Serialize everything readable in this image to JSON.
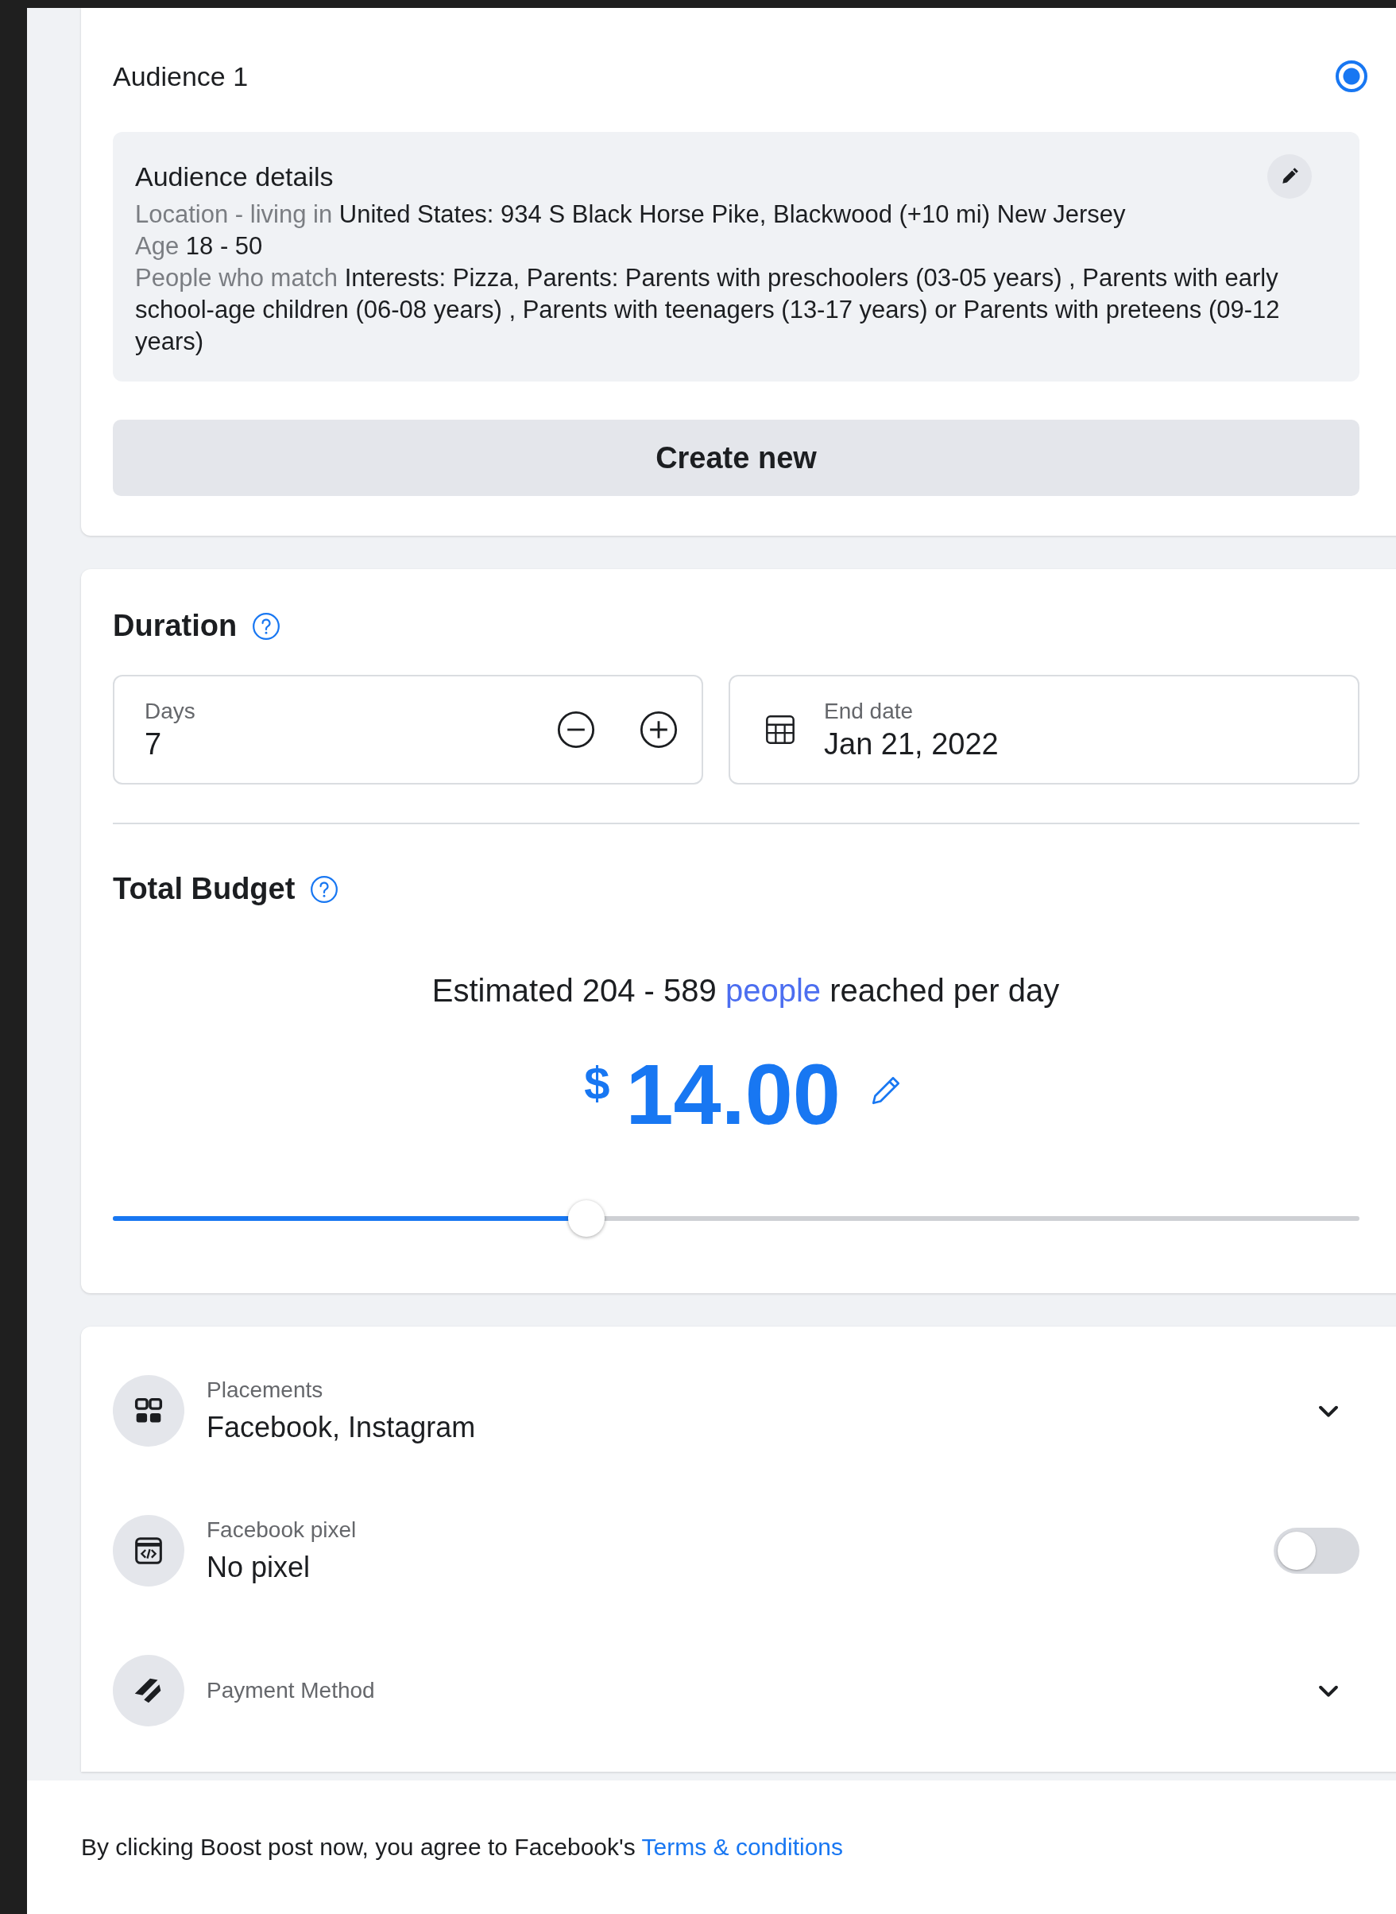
{
  "audience": {
    "name": "Audience 1",
    "selected": true,
    "details": {
      "title": "Audience details",
      "lines": [
        {
          "label": "Location - living in",
          "value": "United States: 934 S Black Horse Pike, Blackwood (+10 mi) New Jersey"
        },
        {
          "label": "Age",
          "value": "18 - 50"
        },
        {
          "label": "People who match",
          "value": "Interests: Pizza, Parents: Parents with preschoolers (03-05 years) , Parents with early school-age children (06-08 years) , Parents with teenagers (13-17 years) or Parents with preteens (09-12 years)"
        }
      ]
    },
    "create_button": "Create new"
  },
  "duration": {
    "title": "Duration",
    "days": {
      "label": "Days",
      "value": "7"
    },
    "end_date": {
      "label": "End date",
      "value": "Jan 21, 2022"
    }
  },
  "budget": {
    "title": "Total Budget",
    "estimate": {
      "prefix": "Estimated 204 - 589",
      "link": "people",
      "suffix": "reached per day"
    },
    "currency": "$",
    "amount": "14.00",
    "slider": {
      "level": 0.38
    }
  },
  "settings": [
    {
      "kind": "dropdown",
      "label": "Placements",
      "value": "Facebook, Instagram"
    },
    {
      "kind": "toggle",
      "label": "Facebook pixel",
      "value": "No pixel",
      "on": false
    },
    {
      "kind": "dropdown",
      "label": "Payment Method"
    }
  ],
  "footer": {
    "text": "By clicking Boost post now, you agree to Facebook's",
    "link": "Terms & conditions"
  }
}
